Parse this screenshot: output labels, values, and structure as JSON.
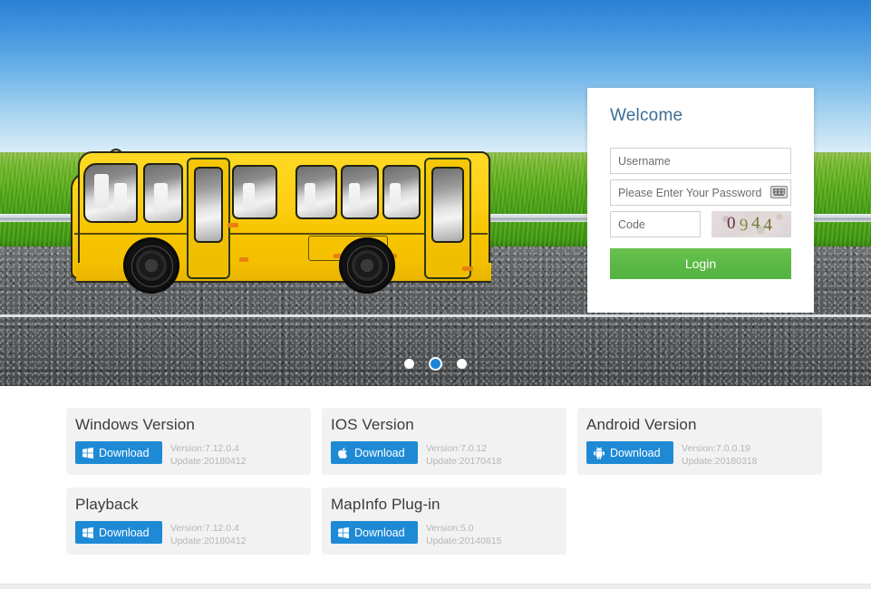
{
  "banner": {
    "scene": {
      "sky_color": "#3f93de",
      "grass_color": "#4da414",
      "road_color": "#55585a",
      "bus_color": "#fdcf14"
    },
    "carousel": {
      "dots": [
        {
          "name": "slide-1",
          "active": false
        },
        {
          "name": "slide-2",
          "active": true
        },
        {
          "name": "slide-3",
          "active": false
        }
      ]
    }
  },
  "login": {
    "title": "Welcome",
    "username": {
      "value": "",
      "placeholder": "Username"
    },
    "password": {
      "value": "",
      "placeholder": "Please Enter Your Password"
    },
    "code": {
      "value": "",
      "placeholder": "Code"
    },
    "keyboard_icon": "keyboard-icon",
    "captcha": {
      "text": "0944",
      "digits": [
        "0",
        "9",
        "4",
        "4"
      ]
    },
    "login_label": "Login",
    "accent_color": "#5bb845",
    "title_color": "#3d6d93"
  },
  "downloads": {
    "button_color": "#1e8ad6",
    "cards": [
      {
        "title": "Windows Version",
        "icon": "windows-icon",
        "download_label": "Download",
        "version": "Version:7.12.0.4",
        "update": "Update:20180412"
      },
      {
        "title": "IOS Version",
        "icon": "apple-icon",
        "download_label": "Download",
        "version": "Version:7.0.12",
        "update": "Update:20170418"
      },
      {
        "title": "Android Version",
        "icon": "android-icon",
        "download_label": "Download",
        "version": "Version:7.0.0.19",
        "update": "Update:20180318"
      },
      {
        "title": "Playback",
        "icon": "windows-icon",
        "download_label": "Download",
        "version": "Version:7.12.0.4",
        "update": "Update:20180412"
      },
      {
        "title": "MapInfo Plug-in",
        "icon": "windows-icon",
        "download_label": "Download",
        "version": "Version:5.0",
        "update": "Update:20140815"
      }
    ]
  }
}
